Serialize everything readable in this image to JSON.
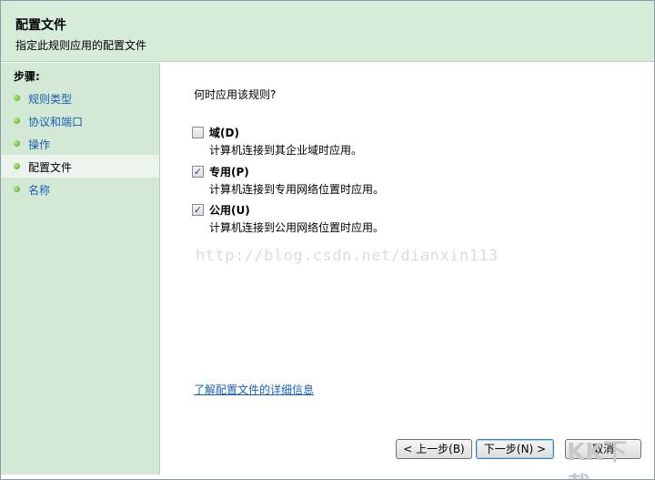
{
  "header": {
    "title": "配置文件",
    "subtitle": "指定此规则应用的配置文件"
  },
  "sidebar": {
    "heading": "步骤:",
    "items": [
      {
        "label": "规则类型"
      },
      {
        "label": "协议和端口"
      },
      {
        "label": "操作"
      },
      {
        "label": "配置文件"
      },
      {
        "label": "名称"
      }
    ],
    "active_index": 3
  },
  "content": {
    "question": "何时应用该规则?",
    "options": [
      {
        "label": "域(D)",
        "description": "计算机连接到其企业域时应用。",
        "checked": false
      },
      {
        "label": "专用(P)",
        "description": "计算机连接到专用网络位置时应用。",
        "checked": true
      },
      {
        "label": "公用(U)",
        "description": "计算机连接到公用网络位置时应用。",
        "checked": true
      }
    ],
    "watermark": "http://blog.csdn.net/dianxin113",
    "learn_more_link": "了解配置文件的详细信息"
  },
  "buttons": {
    "back": "< 上一步(B)",
    "next": "下一步(N) >",
    "cancel": "取消"
  },
  "corner_watermark": "KK下载",
  "colors": {
    "header_bg": "#d6ebd8",
    "sidebar_bg": "#d3e9d5",
    "link": "#1a5fb4",
    "step_dot": "#4aa32c"
  }
}
